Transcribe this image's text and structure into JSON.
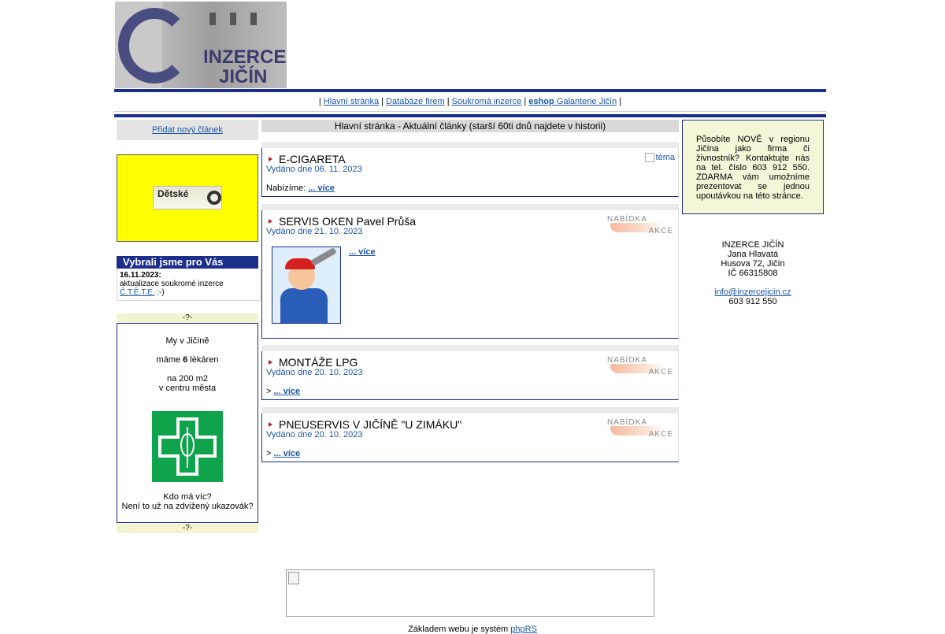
{
  "header": {
    "logo_line1": "INZERCE",
    "logo_line2": "JIČÍN"
  },
  "nav": {
    "sep": "|",
    "items": [
      {
        "label": "Hlavní stránka"
      },
      {
        "label": "Databáze firem"
      },
      {
        "label": "Soukromá inzerce"
      },
      {
        "label_bold": "eshop",
        "label": "Galanterie Jičín"
      }
    ]
  },
  "left": {
    "add_article": "Přidat nový článek",
    "ad_banner_text": "Dětské",
    "picks_title": "Vybrali jsme pro Vás",
    "pick_date": "16.11.2023:",
    "pick_text": "aktualizace soukromé inzerce",
    "pick_link": "Č.T.Ě.T.E.",
    "pick_smiley": ":-)",
    "qmark": "-?-",
    "pharmacy": {
      "line1": "My v Jičíně",
      "line2_pre": "máme",
      "line2_num": "6",
      "line2_post": "lékáren",
      "line3": "na 200 m2",
      "line4": "v centru města",
      "line5": "Kdo má víc?",
      "line6": "Není to už na zdvižený ukazovák?"
    }
  },
  "center": {
    "heading": "Hlavní stránka - Aktuální články   (starší 60ti dnů najdete v historii)",
    "articles": [
      {
        "title": "E-CIGARETA",
        "date": "Vydáno dne 06. 11. 2023",
        "body_prefix": "Nabízíme:",
        "more": "... více",
        "tag": "téma"
      },
      {
        "title": "SERVIS OKEN Pavel Průša",
        "date": "Vydáno dne 21. 10. 2023",
        "body_prefix": "",
        "more": "... více",
        "badge_top": "NABÍDKA",
        "badge_bottom": "AKCE"
      },
      {
        "title": "MONTÁŽE LPG",
        "date": "Vydáno dne 20. 10. 2023",
        "body_prefix": ">",
        "more": "... více",
        "badge_top": "NABÍDKA",
        "badge_bottom": "AKCE"
      },
      {
        "title": "PNEUSERVIS V JIČÍNĚ \"U ZIMÁKU\"",
        "date": "Vydáno dne 20. 10. 2023",
        "body_prefix": ">",
        "more": "... více",
        "badge_top": "NABÍDKA",
        "badge_bottom": "AKCE"
      }
    ]
  },
  "right": {
    "info": "Působíte NOVĚ v regionu Jičína jako firma či živnostník? Kontaktujte nás na tel. číslo 603 912 550. ZDARMA vám umožníme prezentovat se jednou upoutávkou na této stránce.",
    "contact": {
      "name": "INZERCE JIČÍN",
      "person": "Jana Hlavatá",
      "street": "Husova 72, Jičín",
      "ic": "IČ 66315808",
      "email": "info@inzercejicin.cz",
      "phone": "603 912 550"
    }
  },
  "footer": {
    "text": "Základem webu je systém",
    "link": "phpRS"
  }
}
